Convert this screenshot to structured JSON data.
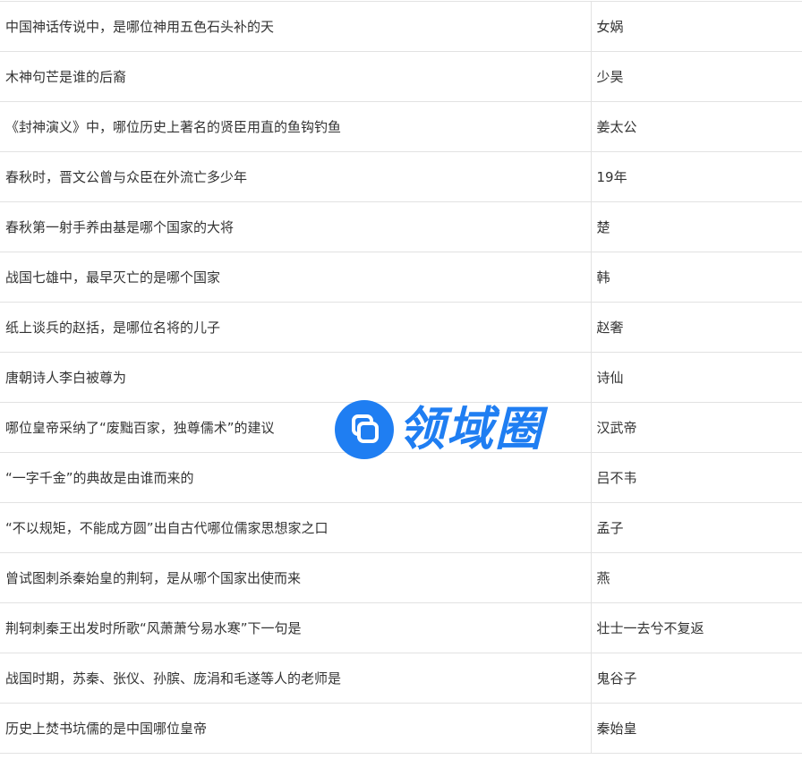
{
  "table": {
    "rows": [
      {
        "question": "中国神话传说中，是哪位神用五色石头补的天",
        "answer": "女娲"
      },
      {
        "question": "木神句芒是谁的后裔",
        "answer": "少昊"
      },
      {
        "question": "《封神演义》中，哪位历史上著名的贤臣用直的鱼钩钓鱼",
        "answer": "姜太公"
      },
      {
        "question": "春秋时，晋文公曾与众臣在外流亡多少年",
        "answer": "19年"
      },
      {
        "question": "春秋第一射手养由基是哪个国家的大将",
        "answer": "楚"
      },
      {
        "question": "战国七雄中，最早灭亡的是哪个国家",
        "answer": "韩"
      },
      {
        "question": "纸上谈兵的赵括，是哪位名将的儿子",
        "answer": "赵奢"
      },
      {
        "question": "唐朝诗人李白被尊为",
        "answer": "诗仙"
      },
      {
        "question": "哪位皇帝采纳了“废黜百家，独尊儒术”的建议",
        "answer": "汉武帝"
      },
      {
        "question": "“一字千金”的典故是由谁而来的",
        "answer": "吕不韦"
      },
      {
        "question": "“不以规矩，不能成方圆”出自古代哪位儒家思想家之口",
        "answer": "孟子"
      },
      {
        "question": "曾试图刺杀秦始皇的荆轲，是从哪个国家出使而来",
        "answer": "燕"
      },
      {
        "question": "荆轲刺秦王出发时所歌“风萧萧兮易水寒”下一句是",
        "answer": "壮士一去兮不复返"
      },
      {
        "question": "战国时期，苏秦、张仪、孙膑、庞涓和毛遂等人的老师是",
        "answer": "鬼谷子"
      },
      {
        "question": "历史上焚书坑儒的是中国哪位皇帝",
        "answer": "秦始皇"
      }
    ]
  },
  "watermark": {
    "text": "领域圈",
    "icon": "stacked-squares-logo-icon",
    "color": "#1f7ef2"
  }
}
